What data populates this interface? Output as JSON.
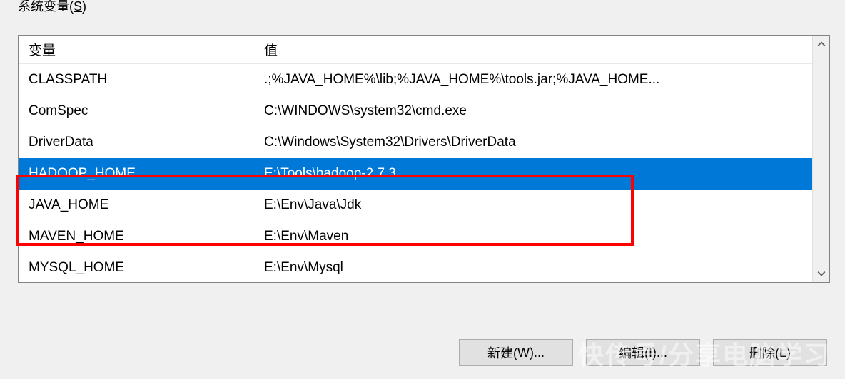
{
  "groupbox": {
    "title_prefix": "系统变量(",
    "title_key": "S",
    "title_suffix": ")"
  },
  "columns": {
    "name": "变量",
    "value": "值"
  },
  "variables": [
    {
      "name": "CLASSPATH",
      "value": ".;%JAVA_HOME%\\lib;%JAVA_HOME%\\tools.jar;%JAVA_HOME..."
    },
    {
      "name": "ComSpec",
      "value": "C:\\WINDOWS\\system32\\cmd.exe"
    },
    {
      "name": "DriverData",
      "value": "C:\\Windows\\System32\\Drivers\\DriverData"
    },
    {
      "name": "HADOOP_HOME",
      "value": "E:\\Tools\\hadoop-2.7.3"
    },
    {
      "name": "JAVA_HOME",
      "value": "E:\\Env\\Java\\Jdk"
    },
    {
      "name": "MAVEN_HOME",
      "value": "E:\\Env\\Maven"
    },
    {
      "name": "MYSQL_HOME",
      "value": "E:\\Env\\Mysql"
    }
  ],
  "selected_index": 3,
  "buttons": {
    "new": {
      "prefix": "新建(",
      "key": "W",
      "suffix": ")..."
    },
    "edit": {
      "prefix": "编辑(",
      "key": "I",
      "suffix": ")..."
    },
    "delete": {
      "prefix": "删除(",
      "key": "L",
      "suffix": ")"
    }
  },
  "watermark": "快传号/分享电脑学习"
}
